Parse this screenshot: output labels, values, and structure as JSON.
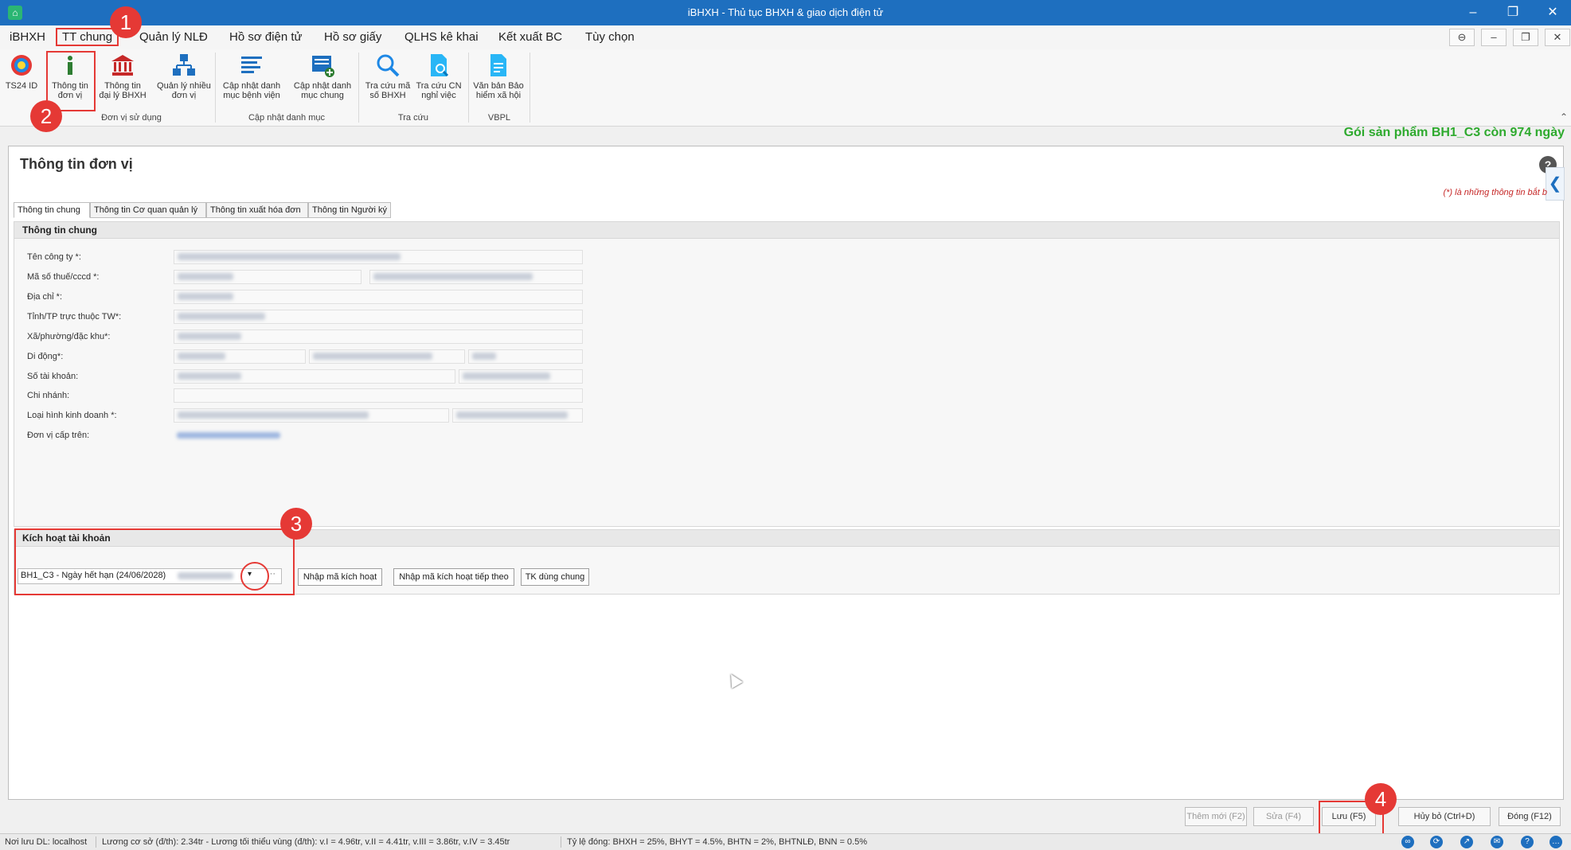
{
  "window": {
    "title": "iBHXH - Thủ tục BHXH & giao dịch điện tử"
  },
  "menu": {
    "items": [
      {
        "label": "iBHXH"
      },
      {
        "label": "TT chung"
      },
      {
        "label": "Quản lý NLĐ"
      },
      {
        "label": "Hồ sơ điện tử"
      },
      {
        "label": "Hồ sơ giấy"
      },
      {
        "label": "QLHS kê khai"
      },
      {
        "label": "Kết xuất BC"
      },
      {
        "label": "Tùy chọn"
      }
    ]
  },
  "ribbon": {
    "buttons": [
      {
        "label": "TS24 ID",
        "icon": "ts24-logo-icon"
      },
      {
        "label": "Thông tin đơn vị",
        "icon": "info-icon"
      },
      {
        "label": "Thông tin đại lý BHXH",
        "icon": "bank-icon"
      },
      {
        "label": "Quản lý nhiều đơn vị",
        "icon": "org-chart-icon"
      },
      {
        "label": "Cập nhật danh mục bệnh viện",
        "icon": "list-icon"
      },
      {
        "label": "Cập nhật danh mục chung",
        "icon": "list-add-icon"
      },
      {
        "label": "Tra cứu mã số BHXH",
        "icon": "search-icon"
      },
      {
        "label": "Tra cứu CN nghỉ việc",
        "icon": "document-search-icon"
      },
      {
        "label": "Văn bản Bảo hiểm xã hội",
        "icon": "document-icon"
      }
    ],
    "groups": [
      {
        "label": "Đơn vị sử dụng"
      },
      {
        "label": "Cập nhật danh mục"
      },
      {
        "label": "Tra cứu"
      },
      {
        "label": "VBPL"
      }
    ]
  },
  "product_notice": "Gói sản phẩm BH1_C3 còn 974 ngày",
  "panel": {
    "title": "Thông tin đơn vị",
    "required_note": "(*) là những thông tin bắt b",
    "tabs": [
      {
        "label": "Thông tin chung"
      },
      {
        "label": "Thông tin Cơ quan quản lý"
      },
      {
        "label": "Thông tin xuất hóa đơn"
      },
      {
        "label": "Thông tin Người ký"
      }
    ],
    "general_section_title": "Thông tin chung",
    "fields": [
      {
        "label": "Tên công ty *:"
      },
      {
        "label": "Mã số thuế/cccd *:"
      },
      {
        "label": "Địa chỉ *:"
      },
      {
        "label": "Tỉnh/TP trực thuộc TW*:"
      },
      {
        "label": "Xã/phường/đặc khu*:"
      },
      {
        "label": "Di động*:"
      },
      {
        "label": "Số tài khoản:"
      },
      {
        "label": "Chi nhánh:"
      },
      {
        "label": "Loại hình kinh doanh *:"
      },
      {
        "label": "Đơn vị cấp trên:"
      }
    ],
    "activation": {
      "section_title": "Kích hoạt tài khoản",
      "combo_value": "BH1_C3 - Ngày hết hạn (24/06/2028)",
      "more": "···",
      "btn_enter_code": "Nhập mã kích hoạt",
      "btn_enter_next": "Nhập mã kích hoạt tiếp theo",
      "btn_shared": "TK dùng chung"
    }
  },
  "footer_buttons": {
    "add": "Thêm mới (F2)",
    "edit": "Sửa (F4)",
    "save": "Lưu (F5)",
    "cancel": "Hủy bỏ (Ctrl+D)",
    "close": "Đóng (F12)"
  },
  "statusbar": {
    "storage": "Nơi lưu DL: localhost",
    "salary": "Lương cơ sở (đ/th): 2.34tr - Lương tối thiểu vùng (đ/th): v.I = 4.96tr, v.II = 4.41tr, v.III = 3.86tr, v.IV = 3.45tr",
    "rates": "Tỷ lệ đóng: BHXH = 25%, BHYT = 4.5%, BHTN = 2%, BHTNLĐ, BNN = 0.5%"
  },
  "annotations": [
    "1",
    "2",
    "3",
    "4"
  ]
}
